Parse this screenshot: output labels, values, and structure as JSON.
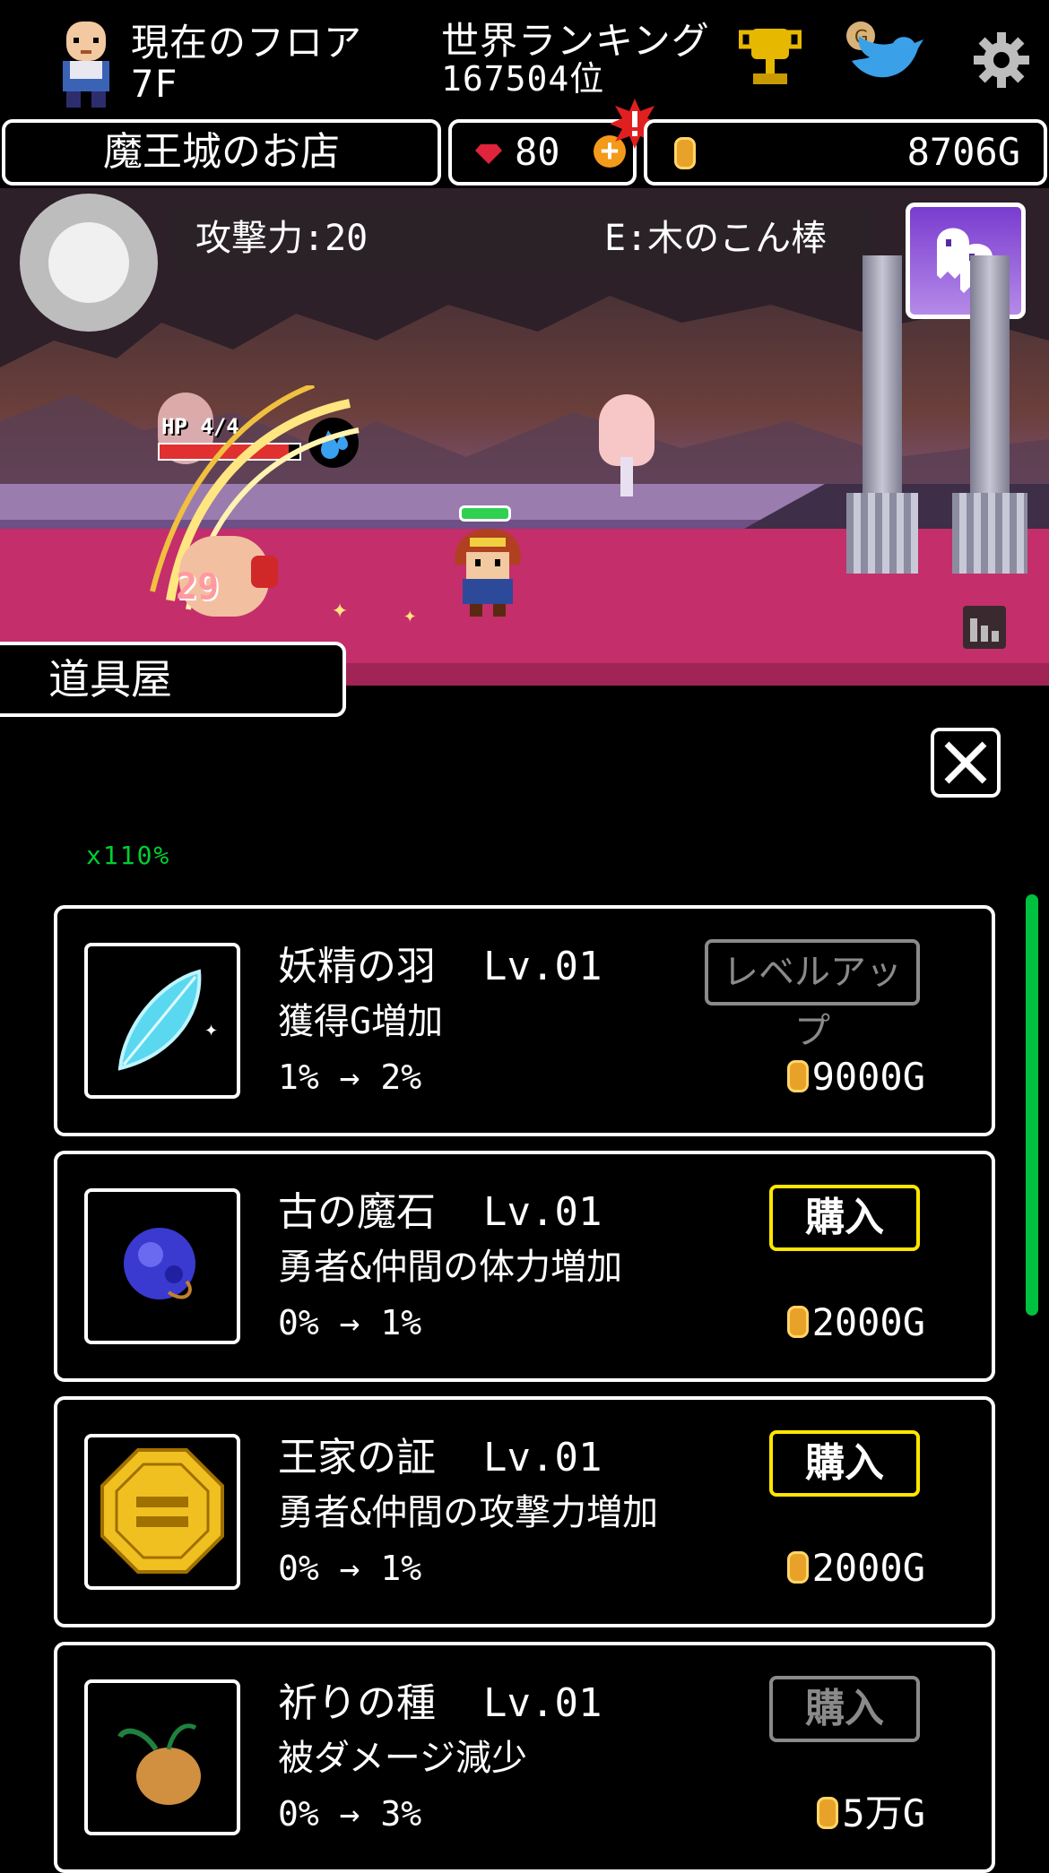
{
  "hud": {
    "floor_label": "現在のフロア",
    "floor_value": "7F",
    "ranking_label": "世界ランキング",
    "ranking_value": "167504位"
  },
  "currency_bar": {
    "shop_title": "魔王城のお店",
    "gems": "80",
    "gold": "8706G"
  },
  "battle": {
    "attack_power": "攻撃力:20",
    "equipment": "E:木のこん棒",
    "enemy_hp_label": "HP 4/4",
    "damage_number": "29"
  },
  "shop": {
    "tab_label": "道具屋",
    "multiplier": "x110%",
    "items": [
      {
        "name": "妖精の羽",
        "level": "Lv.01",
        "effect": "獲得G増加",
        "change": "1% → 2%",
        "price": "9000G",
        "button": "レベルアップ",
        "button_state": "disabled"
      },
      {
        "name": "古の魔石",
        "level": "Lv.01",
        "effect": "勇者&仲間の体力増加",
        "change": "0% → 1%",
        "price": "2000G",
        "button": "購入",
        "button_state": "enabled"
      },
      {
        "name": "王家の証",
        "level": "Lv.01",
        "effect": "勇者&仲間の攻撃力増加",
        "change": "0% → 1%",
        "price": "2000G",
        "button": "購入",
        "button_state": "enabled"
      },
      {
        "name": "祈りの種",
        "level": "Lv.01",
        "effect": "被ダメージ減少",
        "change": "0% → 3%",
        "price": "5万G",
        "button": "購入",
        "button_state": "disabled"
      }
    ]
  },
  "colors": {
    "accent_yellow": "#ffe600",
    "scrollbar_green": "#00c040",
    "multiplier_green": "#00d030",
    "coin_gold": "#e8a22a"
  }
}
